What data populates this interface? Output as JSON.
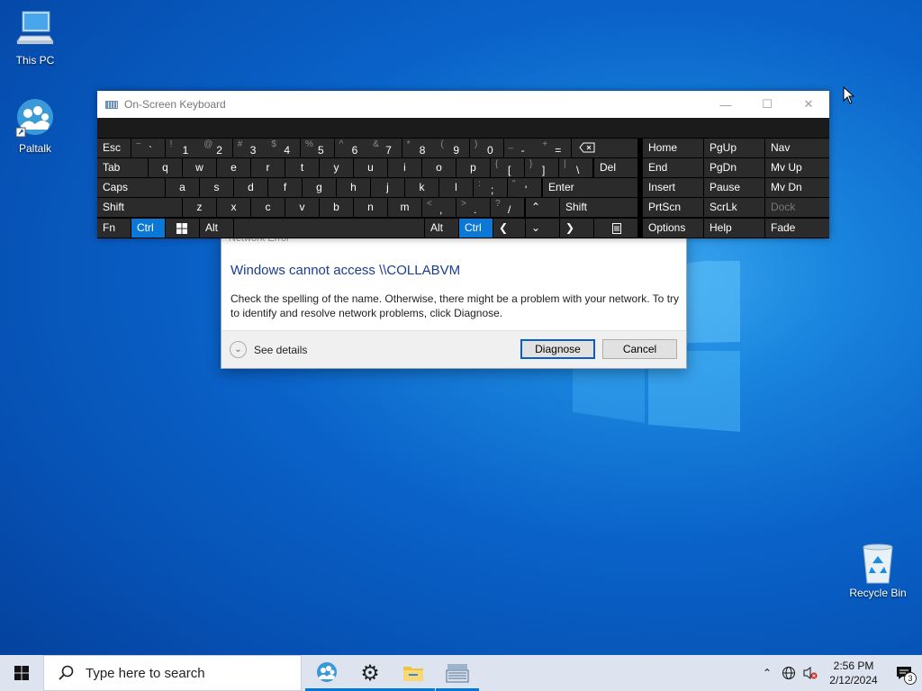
{
  "desktop": {
    "icons": {
      "this_pc": "This PC",
      "paltalk": "Paltalk",
      "recycle_bin": "Recycle Bin"
    }
  },
  "osk": {
    "title": "On-Screen Keyboard",
    "keys": {
      "esc": "Esc",
      "tab": "Tab",
      "caps": "Caps",
      "shift_l": "Shift",
      "fn": "Fn",
      "ctrl_l": "Ctrl",
      "alt_l": "Alt",
      "alt_r": "Alt",
      "ctrl_r": "Ctrl",
      "del": "Del",
      "enter": "Enter",
      "shift_r": "Shift",
      "home": "Home",
      "pgup": "PgUp",
      "nav": "Nav",
      "end": "End",
      "pgdn": "PgDn",
      "mvup": "Mv Up",
      "insert": "Insert",
      "pause": "Pause",
      "mvdn": "Mv Dn",
      "prtscn": "PrtScn",
      "scrlk": "ScrLk",
      "dock": "Dock",
      "options": "Options",
      "help": "Help",
      "fade": "Fade"
    },
    "row1": [
      {
        "s": "~",
        "c": "`"
      },
      {
        "s": "!",
        "c": "1"
      },
      {
        "s": "@",
        "c": "2"
      },
      {
        "s": "#",
        "c": "3"
      },
      {
        "s": "$",
        "c": "4"
      },
      {
        "s": "%",
        "c": "5"
      },
      {
        "s": "^",
        "c": "6"
      },
      {
        "s": "&",
        "c": "7"
      },
      {
        "s": "*",
        "c": "8"
      },
      {
        "s": "(",
        "c": "9"
      },
      {
        "s": ")",
        "c": "0"
      },
      {
        "s": "_",
        "c": "-"
      },
      {
        "s": "+",
        "c": "="
      }
    ],
    "row2": [
      "q",
      "w",
      "e",
      "r",
      "t",
      "y",
      "u",
      "i",
      "o",
      "p"
    ],
    "row2_sym": [
      {
        "s": "{",
        "c": "["
      },
      {
        "s": "}",
        "c": "]"
      },
      {
        "s": "|",
        "c": "\\"
      }
    ],
    "row3": [
      "a",
      "s",
      "d",
      "f",
      "g",
      "h",
      "j",
      "k",
      "l"
    ],
    "row3_sym": [
      {
        "s": ":",
        "c": ";"
      },
      {
        "s": "\"",
        "c": "'"
      }
    ],
    "row4": [
      "z",
      "x",
      "c",
      "v",
      "b",
      "n",
      "m"
    ],
    "row4_sym": [
      {
        "s": "<",
        "c": ","
      },
      {
        "s": ">",
        "c": "."
      },
      {
        "s": "?",
        "c": "/"
      }
    ]
  },
  "dialog": {
    "title": "Network Error",
    "heading": "Windows cannot access \\\\COLLABVM",
    "body": "Check the spelling of the name. Otherwise, there might be a problem with your network. To try to identify and resolve network problems, click Diagnose.",
    "see_details": "See details",
    "diagnose": "Diagnose",
    "cancel": "Cancel"
  },
  "taskbar": {
    "search_placeholder": "Type here to search",
    "time": "2:56 PM",
    "date": "2/12/2024",
    "notification_count": "3"
  }
}
